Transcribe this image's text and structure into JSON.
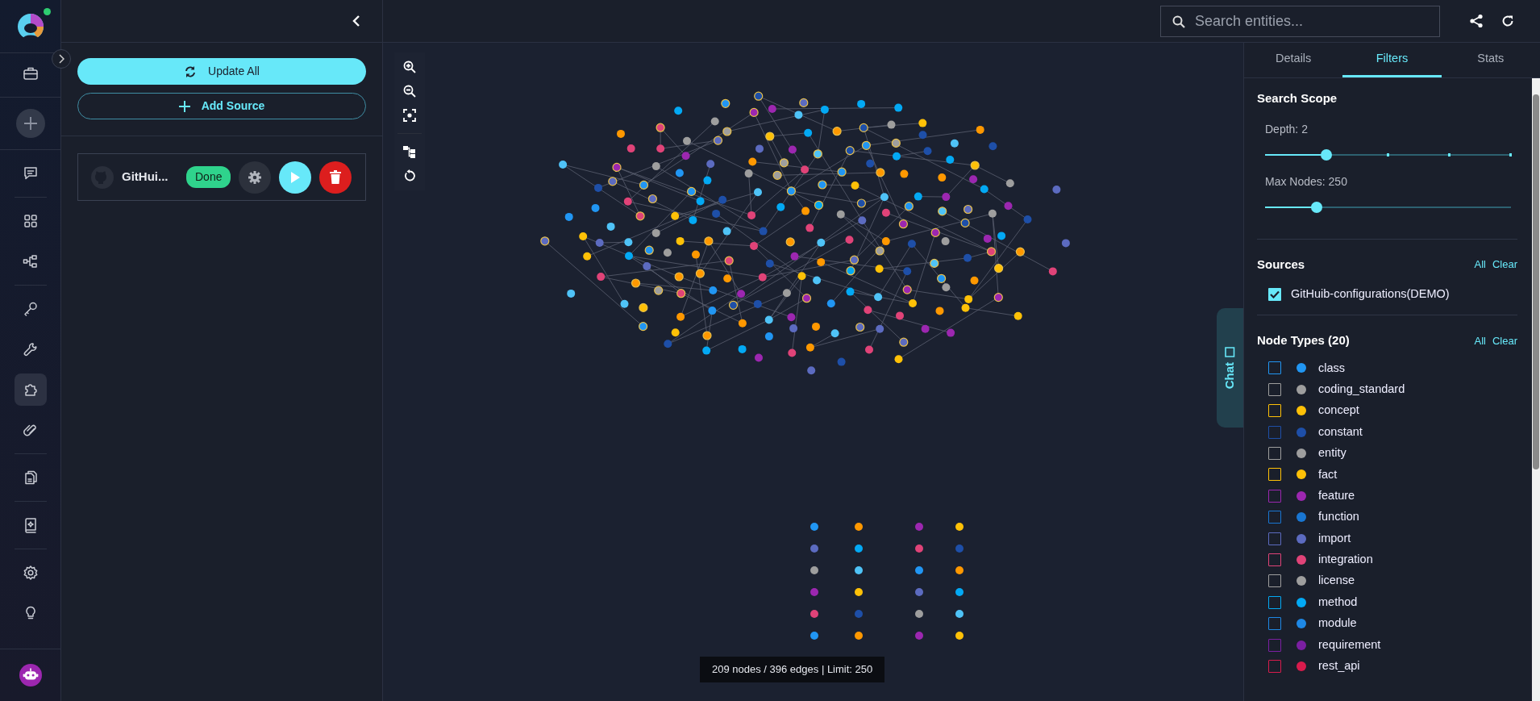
{
  "sidebar": {
    "online": true,
    "items": [
      {
        "kind": "link",
        "selected": false
      },
      {
        "kind": "add",
        "selected": false
      },
      {
        "kind": "link",
        "selected": false
      },
      {
        "kind": "link",
        "selected": false
      },
      {
        "kind": "link",
        "selected": false
      },
      {
        "kind": "link",
        "selected": false
      },
      {
        "kind": "link",
        "selected": false
      },
      {
        "kind": "link",
        "selected": true
      },
      {
        "kind": "link",
        "selected": false
      },
      {
        "kind": "link",
        "selected": false
      },
      {
        "kind": "link",
        "selected": false
      },
      {
        "kind": "link",
        "selected": false
      },
      {
        "kind": "link",
        "selected": false
      }
    ]
  },
  "left_panel": {
    "buttons": [
      {
        "kind": "primary",
        "label": "Update All"
      },
      {
        "kind": "outline",
        "label": "Add Source"
      }
    ],
    "sources": [
      {
        "name": "GitHui...",
        "status": "Done"
      }
    ]
  },
  "search": {
    "placeholder": "Search entities..."
  },
  "graph": {
    "status": "209 nodes / 396 edges | Limit: 250"
  },
  "chat_tab": {
    "label": "Chat"
  },
  "right_panel": {
    "tabs": [
      {
        "label": "Details",
        "selected": false
      },
      {
        "label": "Filters",
        "selected": true
      },
      {
        "label": "Stats",
        "selected": false
      }
    ],
    "search_scope": {
      "title": "Search Scope",
      "sliders": [
        {
          "label": "Depth: 2",
          "kind": "stepped",
          "level": 0.25
        },
        {
          "label": "Max Nodes: 250",
          "kind": "continuous",
          "level": 0.21
        }
      ]
    },
    "sources": {
      "title": "Sources",
      "actions": [
        "All",
        "Clear"
      ],
      "items": [
        {
          "label": "GitHuib-configurations(DEMO)",
          "checked": true
        }
      ]
    },
    "node_types": {
      "title": "Node Types (20)",
      "actions": [
        "All",
        "Clear"
      ],
      "items": [
        {
          "label": "class",
          "color": "#2196f3",
          "checked": false
        },
        {
          "label": "coding_standard",
          "color": "#9e9e9e",
          "checked": false
        },
        {
          "label": "concept",
          "color": "#ffc107",
          "checked": false
        },
        {
          "label": "constant",
          "color": "#1e4fa8",
          "checked": false
        },
        {
          "label": "entity",
          "color": "#9e9e9e",
          "checked": false
        },
        {
          "label": "fact",
          "color": "#ffc107",
          "checked": false
        },
        {
          "label": "feature",
          "color": "#9c27b0",
          "checked": false
        },
        {
          "label": "function",
          "color": "#1976d2",
          "checked": false
        },
        {
          "label": "import",
          "color": "#5c6bc0",
          "checked": false
        },
        {
          "label": "integration",
          "color": "#e04378",
          "checked": false
        },
        {
          "label": "license",
          "color": "#9e9e9e",
          "checked": false
        },
        {
          "label": "method",
          "color": "#03a9f4",
          "checked": false
        },
        {
          "label": "module",
          "color": "#1e88e5",
          "checked": false
        },
        {
          "label": "requirement",
          "color": "#7b1fa2",
          "checked": false
        },
        {
          "label": "rest_api",
          "color": "#d81b4c",
          "checked": false
        }
      ]
    }
  }
}
